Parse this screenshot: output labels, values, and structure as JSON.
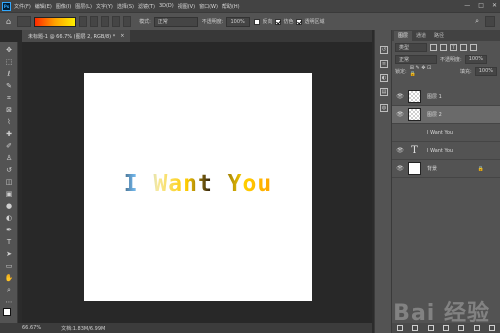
{
  "menubar": {
    "logo": "Ps",
    "items": [
      "文件(F)",
      "编辑(E)",
      "图像(I)",
      "图层(L)",
      "文字(Y)",
      "选择(S)",
      "滤镜(T)",
      "3D(D)",
      "视图(V)",
      "窗口(W)",
      "帮助(H)"
    ],
    "window_controls": [
      "—",
      "□",
      "✕"
    ]
  },
  "options": {
    "mode_label": "模式:",
    "mode_value": "正常",
    "opacity_label": "不透明度:",
    "opacity_value": "100%",
    "reverse_label": "反向",
    "dither_label": "仿色",
    "transparency_label": "透明区域",
    "gradient_colors": [
      "#ff2a00",
      "#ffa200",
      "#fff000"
    ]
  },
  "document": {
    "tab_title": "未标题-1 @ 66.7% (图层 2, RGB/8) *",
    "close": "×",
    "canvas_text": "I Want You"
  },
  "status": {
    "zoom": "66.67%",
    "doc_info": "文档:1.83M/6.99M"
  },
  "layers_panel": {
    "tabs": [
      "图层",
      "通道",
      "路径"
    ],
    "kind_label": "类型",
    "blend_mode": "正常",
    "opacity_label": "不透明度:",
    "opacity_value": "100%",
    "lock_label": "锁定:",
    "fill_label": "填充:",
    "fill_value": "100%",
    "layers": [
      {
        "name": "图层 1",
        "visible": true,
        "thumb": "checker",
        "selected": false
      },
      {
        "name": "图层 2",
        "visible": true,
        "thumb": "checker",
        "selected": true
      },
      {
        "name": "I Want You",
        "visible": false,
        "thumb": "checker",
        "selected": false
      },
      {
        "name": "I Want You",
        "visible": true,
        "thumb": "text",
        "selected": false
      },
      {
        "name": "背景",
        "visible": true,
        "thumb": "white",
        "selected": false,
        "locked": true
      }
    ]
  },
  "watermark": "Bai 经验"
}
